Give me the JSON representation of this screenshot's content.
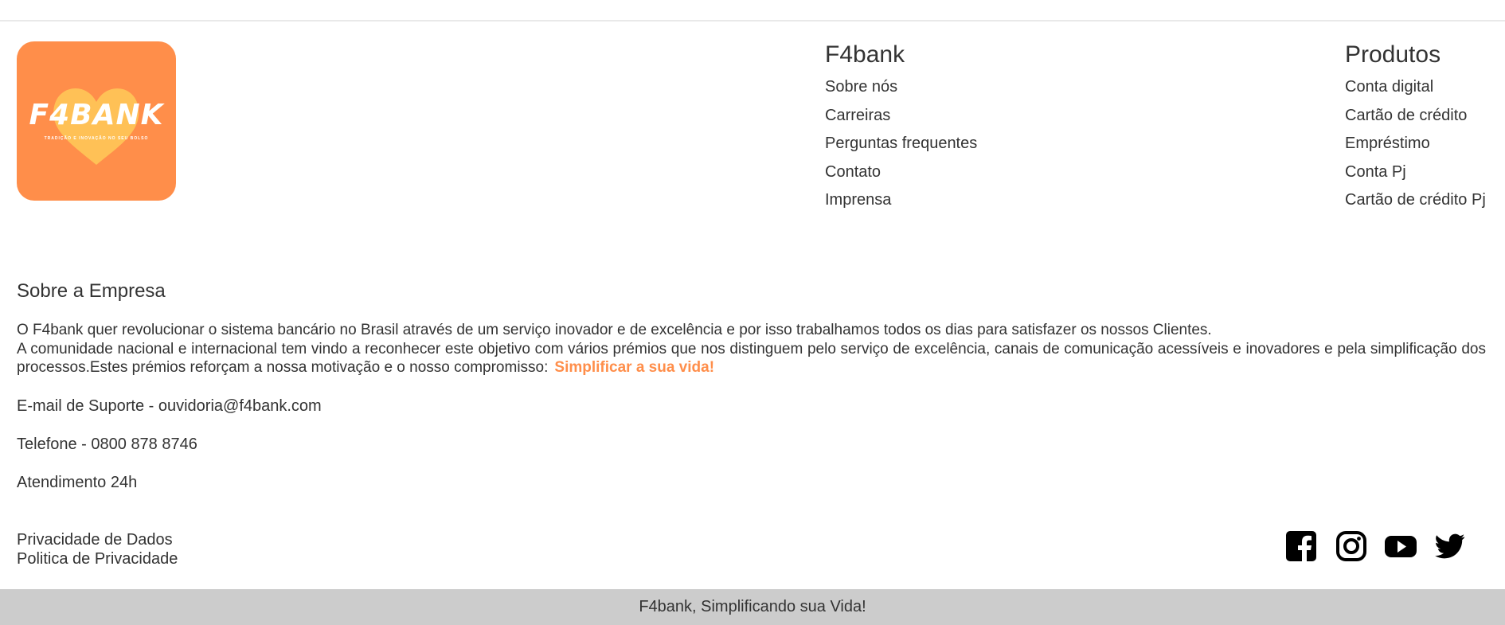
{
  "logo": {
    "word": "F4BANK",
    "tagline": "TRADIÇÃO E INOVAÇÃO NO SEU BOLSO",
    "bg_color": "#ff8e4a",
    "heart_color": "#ffc658"
  },
  "columns": {
    "f4bank": {
      "title": "F4bank",
      "links": [
        "Sobre nós",
        "Carreiras",
        "Perguntas frequentes",
        "Contato",
        "Imprensa"
      ]
    },
    "produtos": {
      "title": "Produtos",
      "links": [
        "Conta digital",
        "Cartão de crédito",
        "Empréstimo",
        "Conta Pj",
        "Cartão de crédito Pj"
      ]
    }
  },
  "about": {
    "title": "Sobre a Empresa",
    "line1": "O F4bank quer revolucionar o sistema bancário no Brasil através de um serviço inovador e de excelência e por isso trabalhamos todos os dias para satisfazer os nossos Clientes.",
    "line2": "A comunidade nacional e internacional tem vindo a reconhecer este objetivo com vários prémios que nos distinguem pelo serviço de excelência, canais de comunicação acessíveis e inovadores e pela simplificação dos processos.Estes prémios reforçam a nossa motivação e o nosso compromisso:",
    "highlight": "Simplificar a sua vida!",
    "highlight_color": "#ff8e4a"
  },
  "contact": {
    "email": "E-mail de Suporte - ouvidoria@f4bank.com",
    "phone": "Telefone - 0800 878 8746",
    "hours": "Atendimento 24h"
  },
  "legal": {
    "privacy_data": "Privacidade de Dados",
    "privacy_policy": "Politica de Privacidade"
  },
  "social": [
    "facebook-icon",
    "instagram-icon",
    "youtube-icon",
    "twitter-icon"
  ],
  "footer_bar": {
    "text": "F4bank, Simplificando sua Vida!",
    "bg_color": "#cccccc"
  }
}
